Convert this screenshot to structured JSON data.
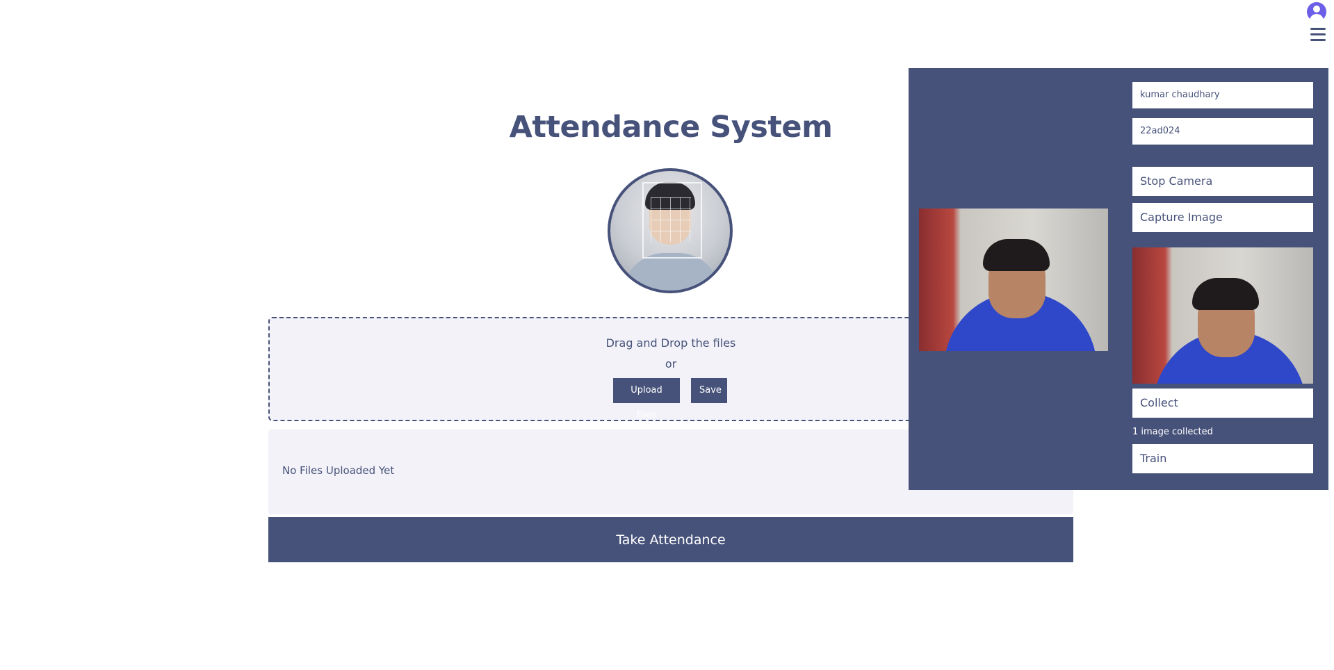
{
  "header": {
    "avatar_icon": "user-avatar-icon",
    "menu_icon": "hamburger-menu-icon"
  },
  "main": {
    "title": "Attendance System",
    "dropzone": {
      "drag_text": "Drag and Drop the files",
      "or_text": "or",
      "upload_label": "Upload Files",
      "save_label": "Save"
    },
    "files": {
      "empty_text": "No Files Uploaded Yet"
    },
    "take_attendance_label": "Take Attendance"
  },
  "panel": {
    "name_value": "kumar chaudhary",
    "id_value": "22ad024",
    "stop_camera_label": "Stop Camera",
    "capture_label": "Capture Image",
    "collect_label": "Collect",
    "status_text": "1 image collected",
    "train_label": "Train"
  },
  "colors": {
    "primary": "#47527a",
    "surface": "#f2f2f8",
    "avatar": "#6d5ee8"
  }
}
